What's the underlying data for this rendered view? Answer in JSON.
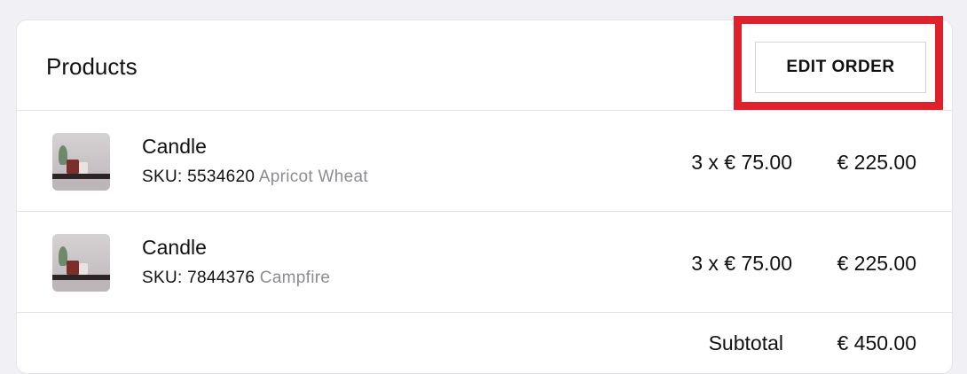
{
  "products_card": {
    "title": "Products",
    "edit_button_label": "EDIT ORDER",
    "highlight_color": "#e0202a",
    "items": [
      {
        "name": "Candle",
        "sku_label": "SKU: 5534620",
        "variant": "Apricot Wheat",
        "quantity_price": "3 x € 75.00",
        "line_total": "€ 225.00",
        "thumbnail": "candle-product-image"
      },
      {
        "name": "Candle",
        "sku_label": "SKU: 7844376",
        "variant": "Campfire",
        "quantity_price": "3 x € 75.00",
        "line_total": "€ 225.00",
        "thumbnail": "candle-product-image"
      }
    ],
    "subtotal_label": "Subtotal",
    "subtotal_value": "€ 450.00"
  }
}
